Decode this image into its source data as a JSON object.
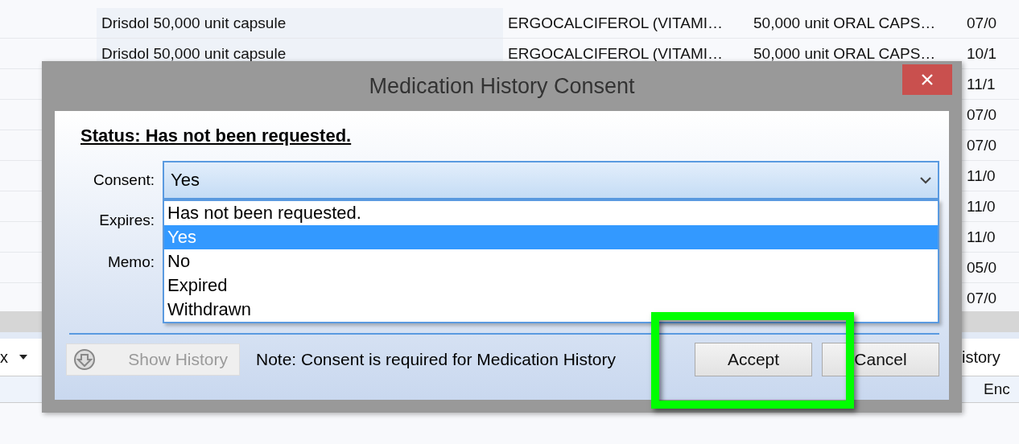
{
  "table": {
    "rows": [
      {
        "column_1": "Drisdol 50,000 unit capsule",
        "column_2": "ERGOCALCIFEROL (VITAMI…",
        "column_3": "50,000 unit ORAL CAPS…",
        "column_4": "07/0"
      },
      {
        "column_1": "Drisdol 50,000 unit capsule",
        "column_2": "ERGOCALCIFEROL (VITAMI…",
        "column_3": "50,000 unit ORAL CAPS…",
        "column_4": "10/1"
      },
      {
        "column_4": "11/1"
      },
      {
        "column_4": "07/0"
      },
      {
        "column_4": "07/0"
      },
      {
        "column_4": "11/0"
      },
      {
        "column_4": "11/0"
      },
      {
        "column_4": "11/0"
      },
      {
        "column_4": "05/0"
      },
      {
        "column_4": "07/0"
      }
    ]
  },
  "toolbar": {
    "left_text": "x",
    "right_text": "istory"
  },
  "lower_table": {
    "column_header": "Enc"
  },
  "dialog": {
    "title": "Medication History Consent",
    "status": "Status: Has not been requested.",
    "fields": [
      {
        "label": "Consent:",
        "value": "Yes"
      },
      {
        "label": "Expires:"
      },
      {
        "label": "Memo:"
      }
    ],
    "dropdown": {
      "expanded": true,
      "options": [
        {
          "label": "Has not been requested.",
          "selected": false
        },
        {
          "label": "Yes",
          "selected": true
        },
        {
          "label": "No",
          "selected": false
        },
        {
          "label": "Expired",
          "selected": false
        },
        {
          "label": "Withdrawn",
          "selected": false
        }
      ]
    },
    "show_history": {
      "label": "Show History",
      "disabled": true
    },
    "note": "Note: Consent is required for Medication History",
    "buttons": [
      {
        "label": "Accept",
        "highlighted": true
      },
      {
        "label": "Cancel",
        "highlighted": false
      }
    ]
  }
}
